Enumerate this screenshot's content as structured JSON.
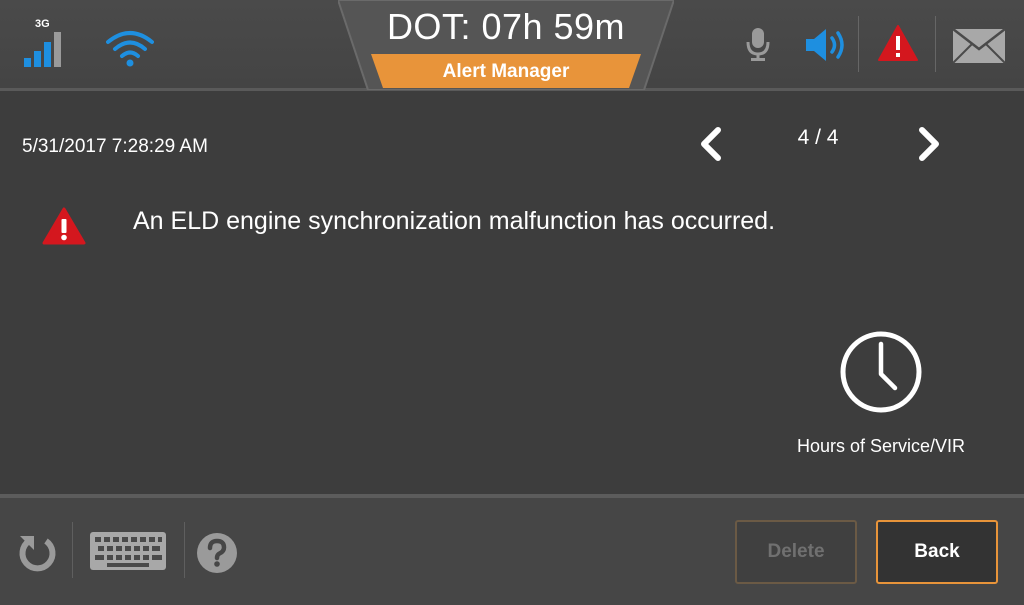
{
  "status": {
    "network": "3G",
    "signal_bars": 4,
    "signal_max": 4
  },
  "header": {
    "dot_clock": "DOT: 07h 59m",
    "tab_label": "Alert Manager"
  },
  "alert": {
    "timestamp": "5/31/2017 7:28:29 AM",
    "pager": "4 / 4",
    "message": "An ELD engine synchronization malfunction has occurred."
  },
  "shortcut": {
    "label": "Hours of Service/VIR",
    "icon": "clock-icon"
  },
  "footer": {
    "delete_label": "Delete",
    "back_label": "Back"
  },
  "colors": {
    "accent_orange": "#e8943a",
    "signal_blue": "#1e8fe0",
    "warning_red": "#d4171e",
    "background": "#3d3d3d"
  }
}
